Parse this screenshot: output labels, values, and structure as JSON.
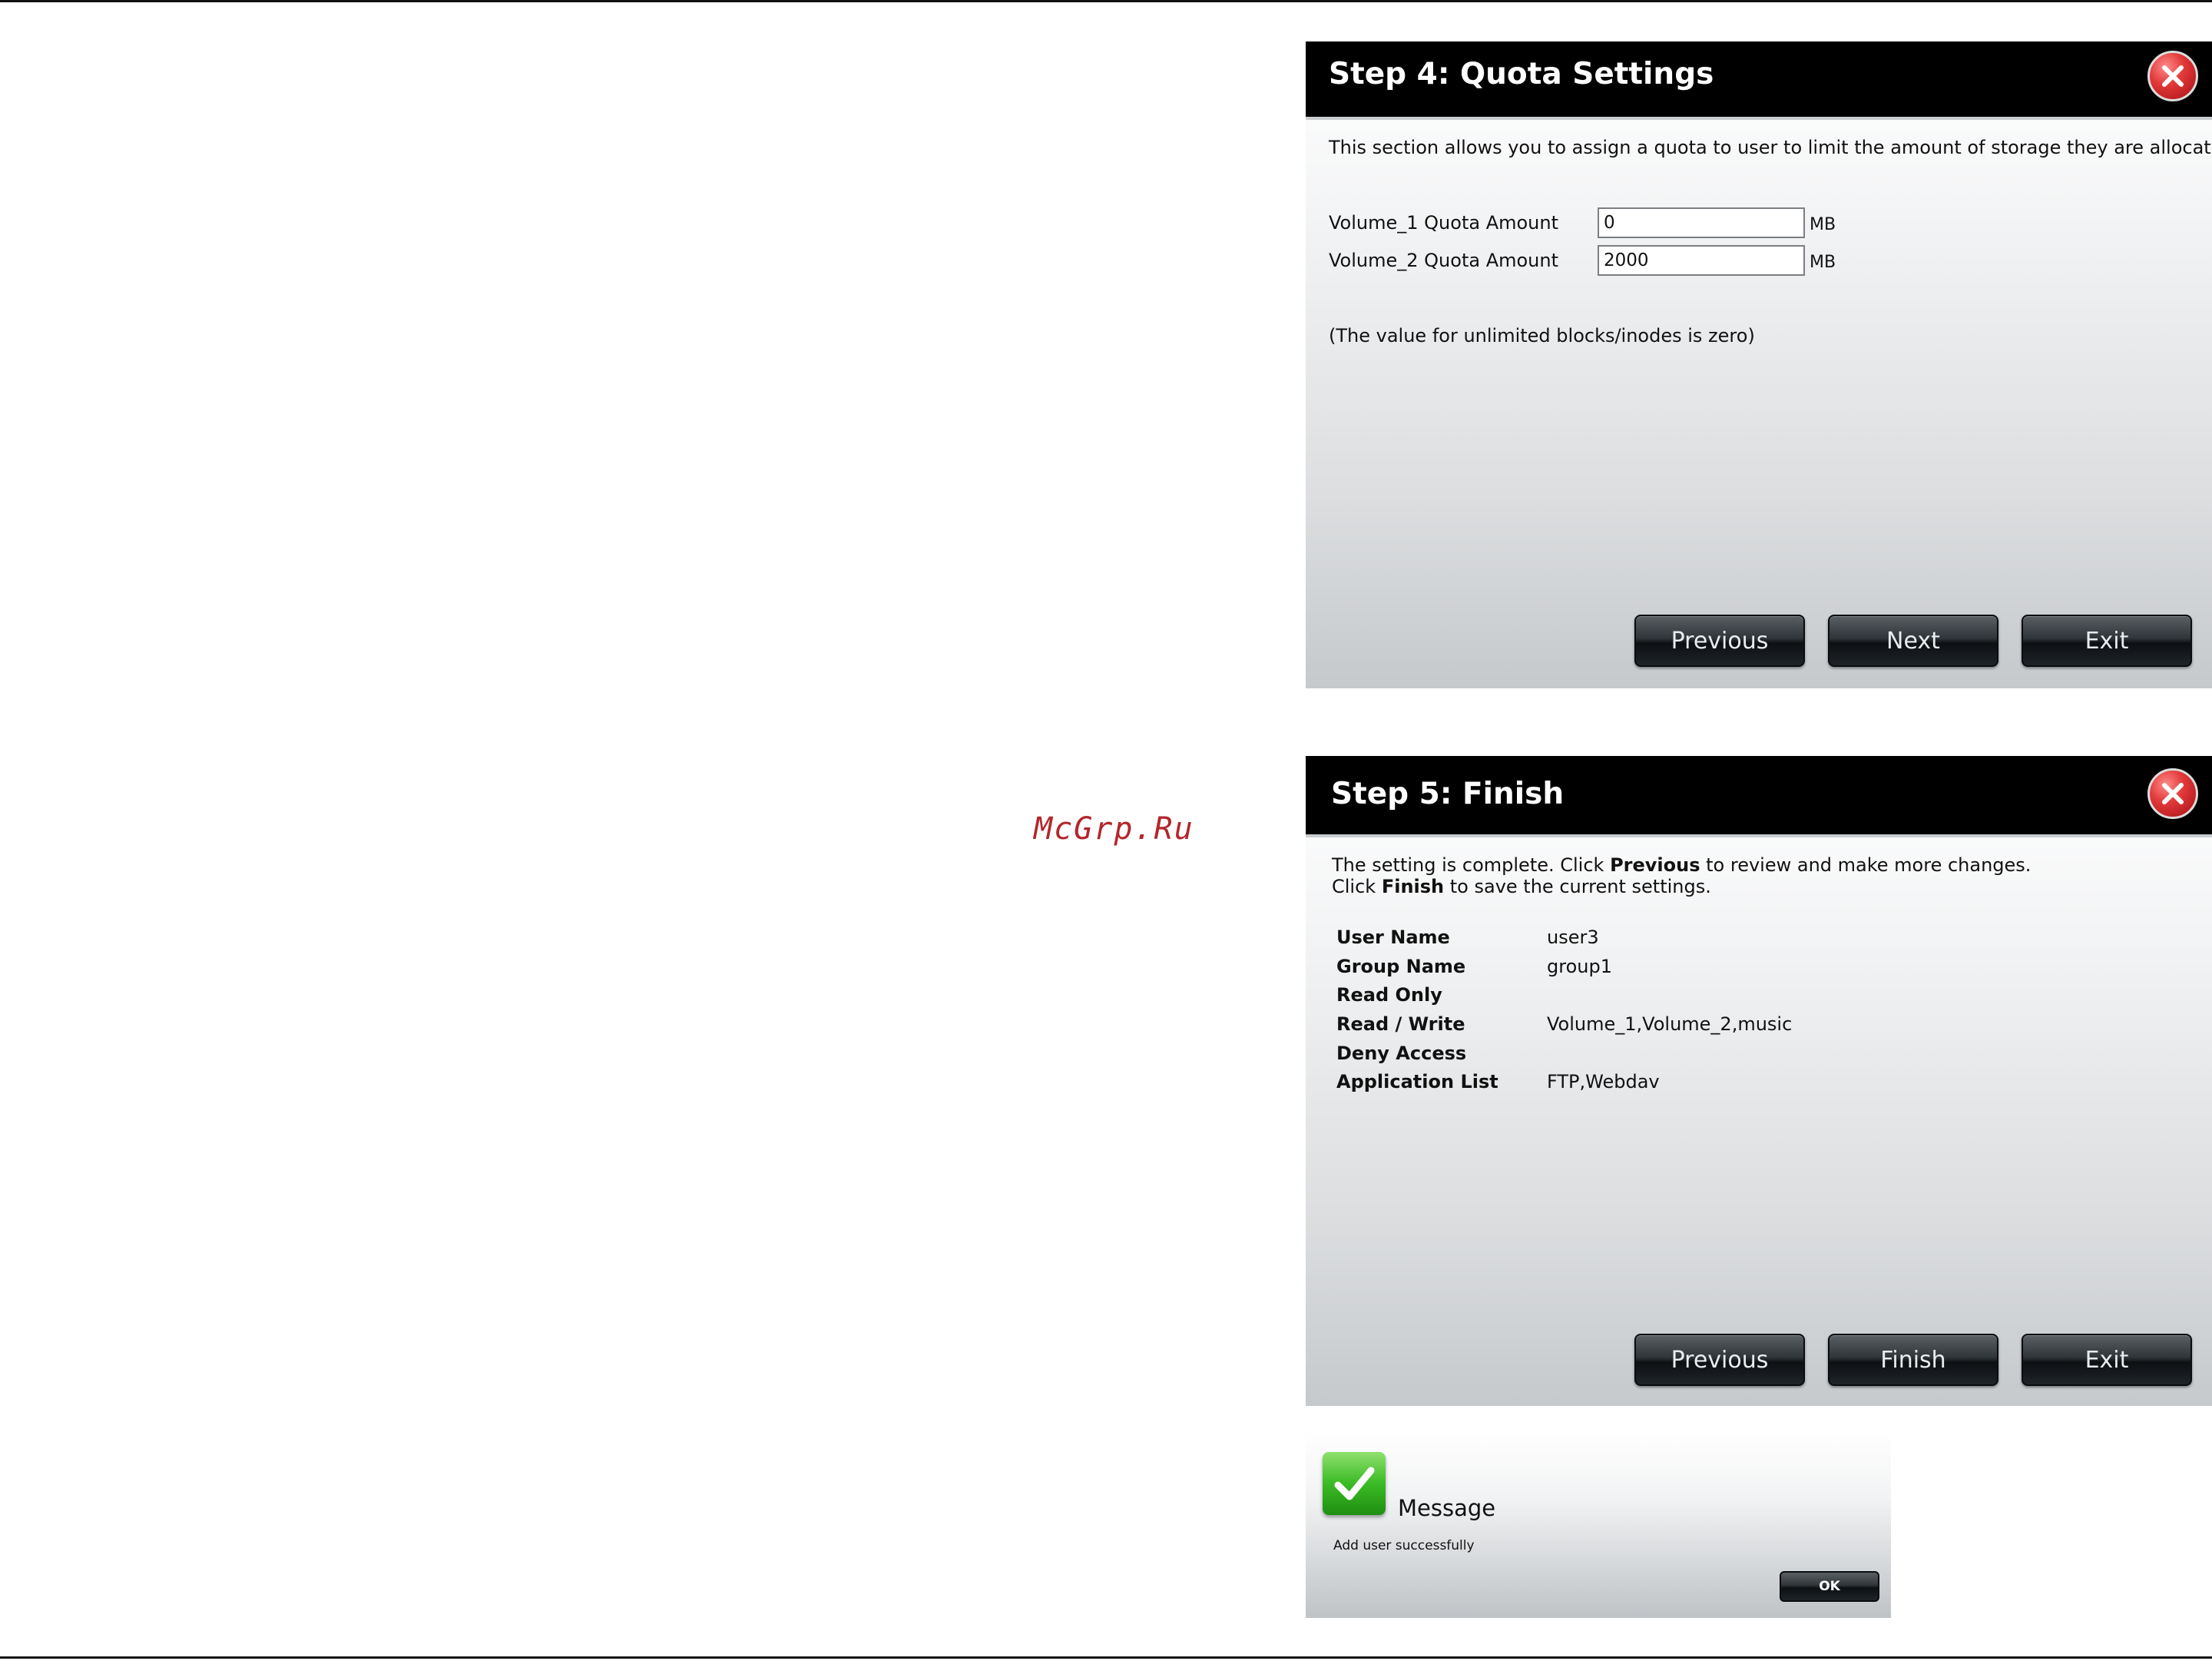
{
  "watermark": "McGrp.Ru",
  "step4": {
    "title": "Step 4: Quota Settings",
    "description": "This section allows you to assign a quota to user to limit the amount of storage they are allocated.",
    "fields": [
      {
        "label": "Volume_1 Quota Amount",
        "value": "0",
        "unit": "MB"
      },
      {
        "label": "Volume_2 Quota Amount",
        "value": "2000",
        "unit": "MB"
      }
    ],
    "note": "(The value for unlimited blocks/inodes is zero)",
    "buttons": {
      "previous": "Previous",
      "next": "Next",
      "exit": "Exit"
    }
  },
  "step5": {
    "title": "Step 5: Finish",
    "line1": {
      "pre": "The setting is complete. Click ",
      "bold": "Previous",
      "post": " to review and make more changes."
    },
    "line2": {
      "pre": "Click ",
      "bold": "Finish",
      "post": " to save the current settings."
    },
    "summary": [
      {
        "key": "User Name",
        "value": "user3"
      },
      {
        "key": "Group Name",
        "value": "group1"
      },
      {
        "key": "Read Only",
        "value": ""
      },
      {
        "key": "Read / Write",
        "value": "Volume_1,Volume_2,music"
      },
      {
        "key": "Deny Access",
        "value": ""
      },
      {
        "key": "Application List",
        "value": "FTP,Webdav"
      }
    ],
    "buttons": {
      "previous": "Previous",
      "finish": "Finish",
      "exit": "Exit"
    }
  },
  "message": {
    "title": "Message",
    "text": "Add user successfully",
    "ok": "OK"
  },
  "colors": {
    "titlebar": "#000000",
    "close": "#e23a3a",
    "check": "#3bbb24",
    "watermark": "#b3262b"
  },
  "icons": {
    "close": "close-icon",
    "success": "checkmark-icon"
  }
}
